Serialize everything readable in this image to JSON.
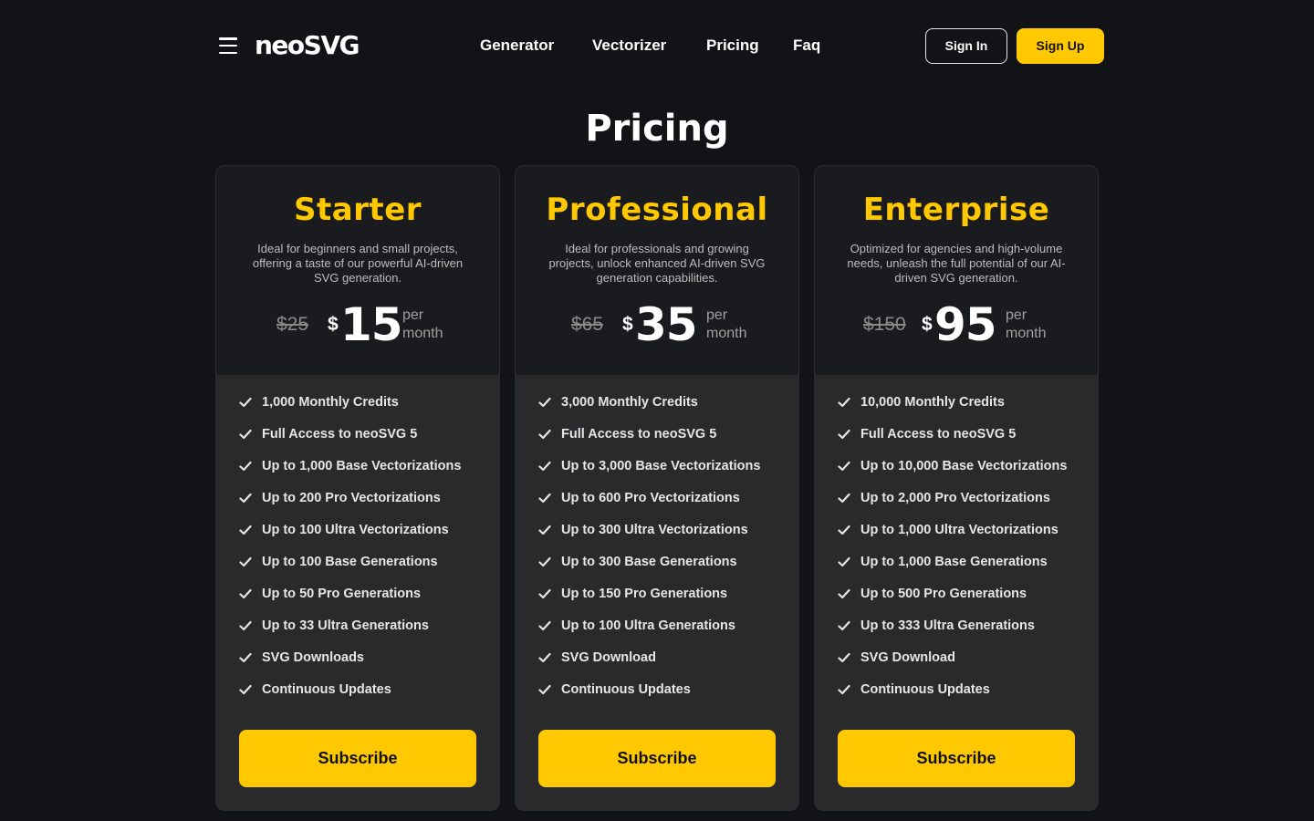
{
  "header": {
    "logo": "neoSVG",
    "nav": [
      {
        "label": "Generator"
      },
      {
        "label": "Vectorizer"
      },
      {
        "label": "Pricing"
      },
      {
        "label": "Faq"
      }
    ],
    "sign_in": "Sign In",
    "sign_up": "Sign Up"
  },
  "page": {
    "title": "Pricing"
  },
  "plans": [
    {
      "name": "Starter",
      "description": "Ideal for beginners and small projects, offering a taste of our powerful AI-driven SVG generation.",
      "old_price": "$25",
      "currency": "$",
      "price": "15",
      "per": "per month",
      "features": [
        "1,000 Monthly Credits",
        "Full Access to neoSVG 5",
        "Up to 1,000 Base Vectorizations",
        "Up to 200 Pro Vectorizations",
        "Up to 100 Ultra Vectorizations",
        "Up to 100 Base Generations",
        "Up to 50 Pro Generations",
        "Up to 33 Ultra Generations",
        "SVG Downloads",
        "Continuous Updates"
      ],
      "cta": "Subscribe"
    },
    {
      "name": "Professional",
      "description": "Ideal for professionals and growing projects, unlock enhanced AI-driven SVG generation capabilities.",
      "old_price": "$65",
      "currency": "$",
      "price": "35",
      "per": "per month",
      "features": [
        "3,000 Monthly Credits",
        "Full Access to neoSVG 5",
        "Up to 3,000 Base Vectorizations",
        "Up to 600 Pro Vectorizations",
        "Up to 300 Ultra Vectorizations",
        "Up to 300 Base Generations",
        "Up to 150 Pro Generations",
        "Up to 100 Ultra Generations",
        "SVG Download",
        "Continuous Updates"
      ],
      "cta": "Subscribe"
    },
    {
      "name": "Enterprise",
      "description": "Optimized for agencies and high-volume needs, unleash the full potential of our AI-driven SVG generation.",
      "old_price": "$150",
      "currency": "$",
      "price": "95",
      "per": "per month",
      "features": [
        "10,000 Monthly Credits",
        "Full Access to neoSVG 5",
        "Up to 10,000 Base Vectorizations",
        "Up to 2,000 Pro Vectorizations",
        "Up to 1,000 Ultra Vectorizations",
        "Up to 1,000 Base Generations",
        "Up to 500 Pro Generations",
        "Up to 333 Ultra Generations",
        "SVG Download",
        "Continuous Updates"
      ],
      "cta": "Subscribe"
    }
  ],
  "icons": {
    "menu": "hamburger-menu-icon",
    "check": "check-icon"
  },
  "colors": {
    "accent": "#ffc800",
    "background": "#121316",
    "card": "#1a1b1e",
    "card_features": "#2a2a2c"
  }
}
